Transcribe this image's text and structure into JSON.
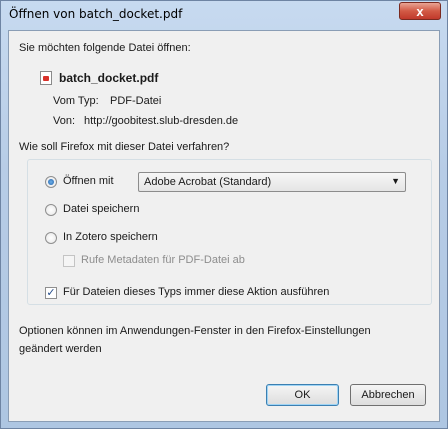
{
  "window": {
    "title": "Öffnen von batch_docket.pdf",
    "close_label": "x"
  },
  "intro": "Sie möchten folgende Datei öffnen:",
  "file": {
    "name": "batch_docket.pdf",
    "type_label": "Vom Typ:",
    "type_value": "PDF-Datei",
    "from_label": "Von:",
    "from_value": "http://goobitest.slub-dresden.de"
  },
  "question": "Wie soll Firefox mit dieser Datei verfahren?",
  "options": {
    "open_with_label": "Öffnen mit",
    "open_with_selected": "Adobe Acrobat  (Standard)",
    "save_label": "Datei speichern",
    "zotero_label": "In Zotero speichern",
    "metadata_label": "Rufe Metadaten für PDF-Datei ab",
    "always_label": "Für Dateien dieses Typs immer diese Aktion ausführen"
  },
  "note": {
    "line1": "Optionen können im Anwendungen-Fenster in den Firefox-Einstellungen",
    "line2": "geändert werden"
  },
  "buttons": {
    "ok": "OK",
    "cancel": "Abbrechen"
  }
}
